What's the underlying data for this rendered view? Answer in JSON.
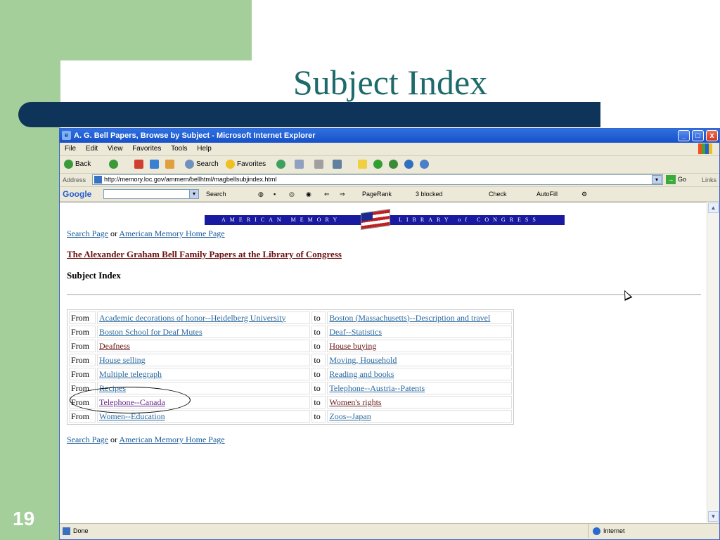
{
  "slide": {
    "title": "Subject Index",
    "number": "19",
    "colors": {
      "green": "#a4cf9b",
      "navy": "#0e3459",
      "title": "#1e6a6a"
    }
  },
  "browser": {
    "title": "A. G. Bell Papers, Browse by Subject - Microsoft Internet Explorer",
    "window_buttons": [
      "_",
      "□",
      "x"
    ],
    "menu": [
      "File",
      "Edit",
      "View",
      "Favorites",
      "Tools",
      "Help"
    ],
    "toolbar": {
      "back": "Back",
      "search": "Search",
      "favorites": "Favorites"
    },
    "address_label": "Address",
    "url": "http://memory.loc.gov/ammem/bellhtml/magbellsubjindex.html",
    "go_label": "Go",
    "links_label": "Links",
    "google": {
      "logo": "Google",
      "search": "Search",
      "pagerank": "PageRank",
      "blocked": "3 blocked",
      "check": "Check",
      "autofill": "AutoFill"
    },
    "status": {
      "left": "Done",
      "zone": "Internet"
    }
  },
  "page": {
    "banner_left": "AMERICAN MEMORY",
    "banner_right": "LIBRARY of CONGRESS",
    "nav": {
      "search_page": "Search Page",
      "or": " or ",
      "am_home": "American Memory Home Page"
    },
    "heading": "The Alexander Graham Bell Family Papers at the Library of Congress",
    "subheading": "Subject Index",
    "from_label": "From",
    "to_label": "to",
    "rows": [
      {
        "from": "Academic decorations of honor--Heidelberg University",
        "to": "Boston (Massachusetts)--Description and travel"
      },
      {
        "from": "Boston School for Deaf Mutes",
        "to": "Deaf--Statistics"
      },
      {
        "from": "Deafness",
        "to": "House buying"
      },
      {
        "from": "House selling",
        "to": "Moving, Household"
      },
      {
        "from": "Multiple telegraph",
        "to": "Reading and books"
      },
      {
        "from": "Recipes",
        "to": "Telephone--Austria--Patents"
      },
      {
        "from": "Telephone--Canada",
        "to": "Women's rights"
      },
      {
        "from": "Women--Education",
        "to": "Zoos--Japan"
      }
    ]
  }
}
